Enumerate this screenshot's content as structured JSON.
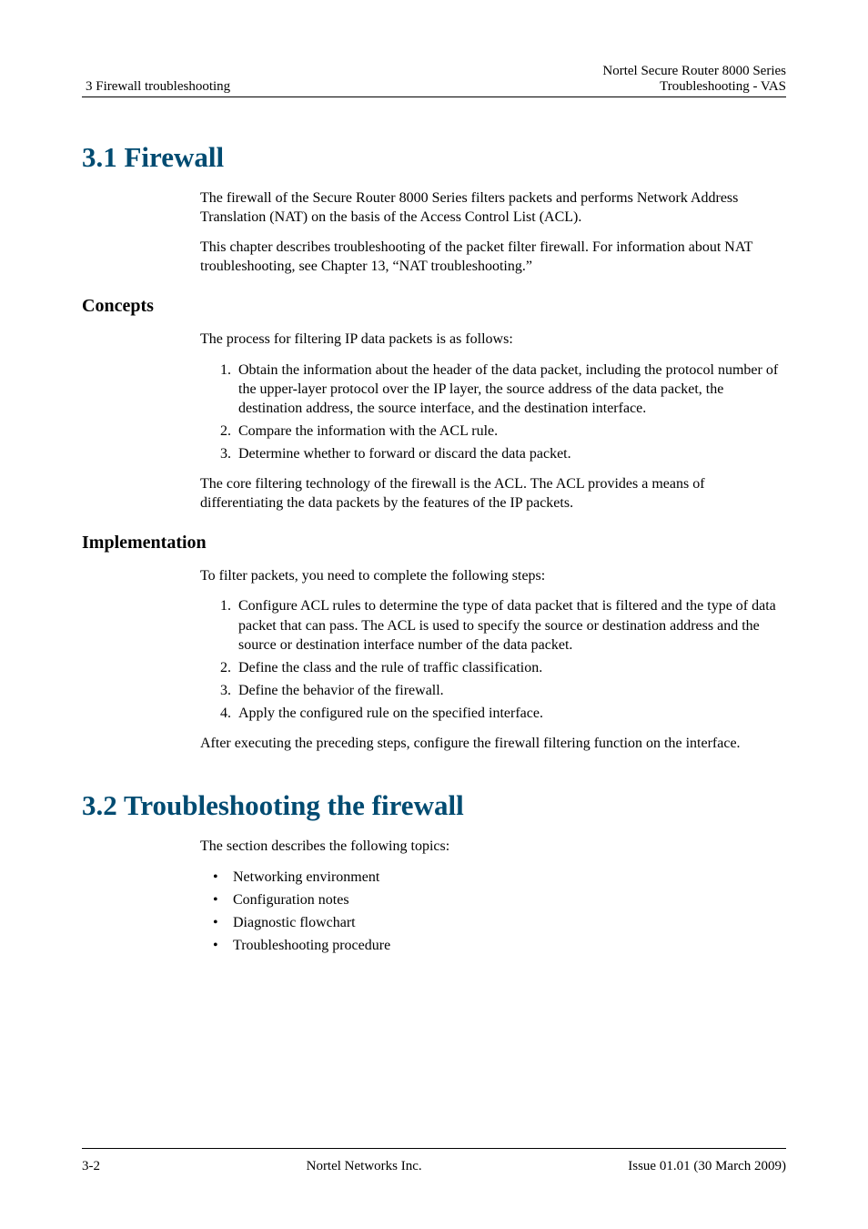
{
  "header": {
    "left": "3 Firewall troubleshooting",
    "right_line1": "Nortel Secure Router 8000 Series",
    "right_line2": "Troubleshooting - VAS"
  },
  "s31": {
    "title": "3.1 Firewall",
    "p1": "The firewall of the Secure Router 8000 Series filters packets and performs Network Address Translation (NAT) on the basis of the Access Control List (ACL).",
    "p2": "This chapter describes troubleshooting of the packet filter firewall. For information about NAT troubleshooting, see Chapter 13, “NAT troubleshooting.”",
    "concepts": {
      "title": "Concepts",
      "p1": "The process for filtering IP data packets is as follows:",
      "items": [
        "Obtain the information about the header of the data packet, including the protocol number of the upper-layer protocol over the IP layer, the source address of the data packet, the destination address, the source interface, and the destination interface.",
        "Compare the information with the ACL rule.",
        "Determine whether to forward or discard the data packet."
      ],
      "p2": "The core filtering technology of the firewall is the ACL. The ACL provides a means of differentiating the data packets by the features of the IP packets."
    },
    "impl": {
      "title": "Implementation",
      "p1": "To filter packets, you need to complete the following steps:",
      "items": [
        "Configure ACL rules to determine the type of data packet that is filtered and the type of data packet that can pass. The ACL is used to specify the source or destination address and the source or destination interface number of the data packet.",
        "Define the class and the rule of traffic classification.",
        "Define the behavior of the firewall.",
        "Apply the configured rule on the specified interface."
      ],
      "p2": "After executing the preceding steps, configure the firewall filtering function on the interface."
    }
  },
  "s32": {
    "title": "3.2 Troubleshooting the firewall",
    "p1": "The section describes the following topics:",
    "items": [
      "Networking environment",
      "Configuration notes",
      "Diagnostic flowchart",
      "Troubleshooting procedure"
    ]
  },
  "footer": {
    "left": "3-2",
    "center": "Nortel Networks Inc.",
    "right": "Issue 01.01 (30 March 2009)"
  }
}
